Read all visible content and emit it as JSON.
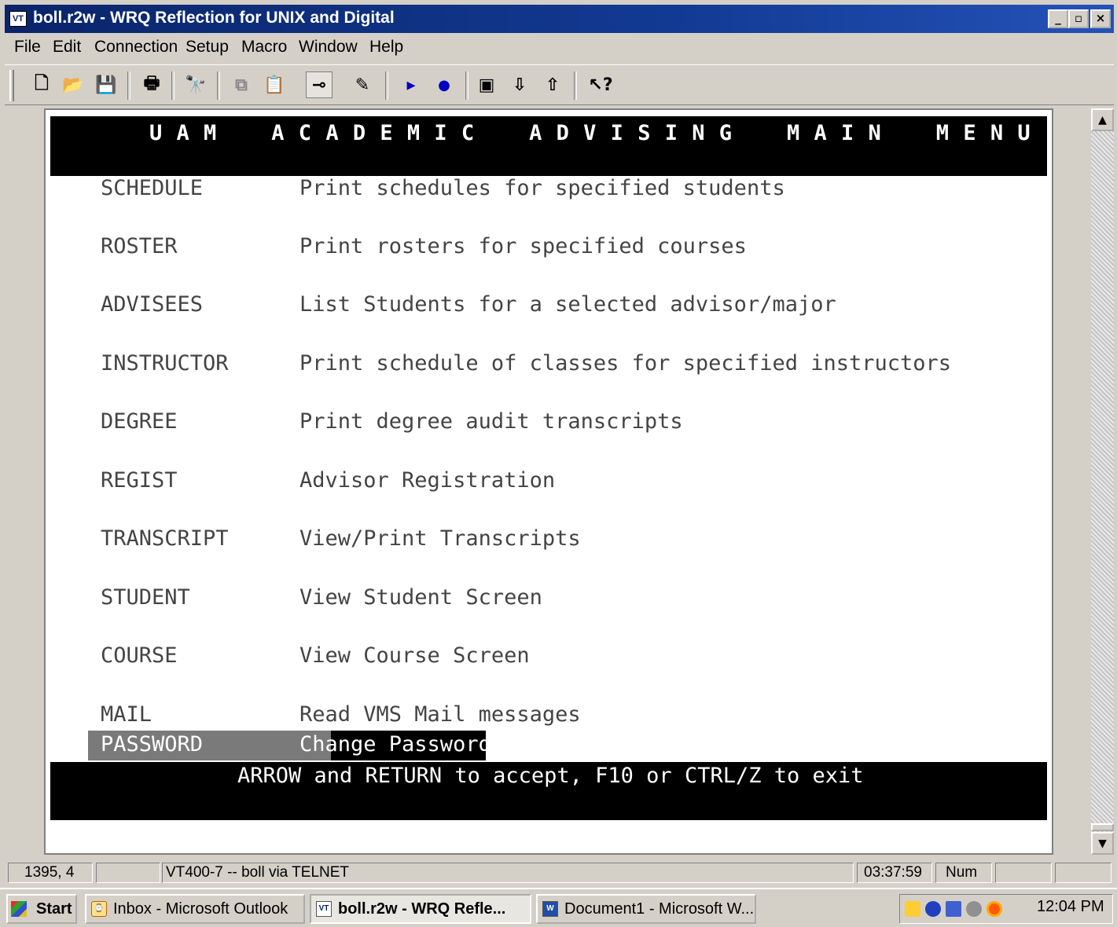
{
  "window": {
    "icon_label": "VT",
    "title": "boll.r2w - WRQ Reflection for UNIX and Digital",
    "controls": [
      "_",
      "▫",
      "×"
    ]
  },
  "menubar": [
    "File",
    "Edit",
    "Connection",
    "Setup",
    "Macro",
    "Window",
    "Help"
  ],
  "toolbar": [
    {
      "name": "new-document-icon",
      "glyph": "🗋"
    },
    {
      "name": "open-folder-icon",
      "glyph": "📂"
    },
    {
      "name": "save-icon",
      "glyph": "💾"
    },
    {
      "name": "print-icon",
      "glyph": "🖶"
    },
    {
      "name": "find-binoculars-icon",
      "glyph": "🔭"
    },
    {
      "name": "copy-icon",
      "glyph": "⧉"
    },
    {
      "name": "paste-icon",
      "glyph": "📋"
    },
    {
      "name": "connect-icon",
      "glyph": "⊸"
    },
    {
      "name": "edit-icon",
      "glyph": "✎"
    },
    {
      "name": "play-macro-icon",
      "glyph": "▸"
    },
    {
      "name": "record-macro-icon",
      "glyph": "●"
    },
    {
      "name": "screen-capture-icon",
      "glyph": "▣"
    },
    {
      "name": "download-icon",
      "glyph": "⇩"
    },
    {
      "name": "upload-icon",
      "glyph": "⇧"
    },
    {
      "name": "context-help-icon",
      "glyph": "↖?"
    }
  ],
  "terminal": {
    "header": "U A M    A C A D E M I C    A D V I S I N G    M A I N    M E N U",
    "items": [
      {
        "key": "SCHEDULE",
        "desc": "Print schedules for specified students"
      },
      {
        "key": "ROSTER",
        "desc": "Print rosters for specified courses"
      },
      {
        "key": "ADVISEES",
        "desc": "List Students for a selected advisor/major"
      },
      {
        "key": "INSTRUCTOR",
        "desc": "Print schedule of classes for specified instructors"
      },
      {
        "key": "DEGREE",
        "desc": "Print degree audit transcripts"
      },
      {
        "key": "REGIST",
        "desc": "Advisor Registration"
      },
      {
        "key": "TRANSCRIPT",
        "desc": "View/Print Transcripts"
      },
      {
        "key": "STUDENT",
        "desc": "View Student Screen"
      },
      {
        "key": "COURSE",
        "desc": "View Course Screen"
      },
      {
        "key": "MAIL",
        "desc": "Read VMS Mail messages"
      }
    ],
    "selected": {
      "key": "PASSWORD",
      "desc": "Change Password"
    },
    "footer": "ARROW and RETURN to accept, F10 or CTRL/Z to exit"
  },
  "statusbar": {
    "cursor": "1395, 4",
    "blank": "",
    "session": "VT400-7 -- boll via TELNET",
    "timer": "03:37:59",
    "num": "Num"
  },
  "taskbar": {
    "start": "Start",
    "tasks": [
      {
        "label": "Inbox - Microsoft Outlook",
        "icon": "⌚"
      },
      {
        "label": "boll.r2w - WRQ Refle...",
        "icon": "VT"
      },
      {
        "label": "Document1 - Microsoft W...",
        "icon": "W"
      }
    ],
    "clock": "12:04 PM"
  },
  "colors": {
    "titlebar": "#0a246a",
    "terminal_bg": "#ffffff",
    "terminal_text": "#444444",
    "selection": "#7a7a7a"
  }
}
